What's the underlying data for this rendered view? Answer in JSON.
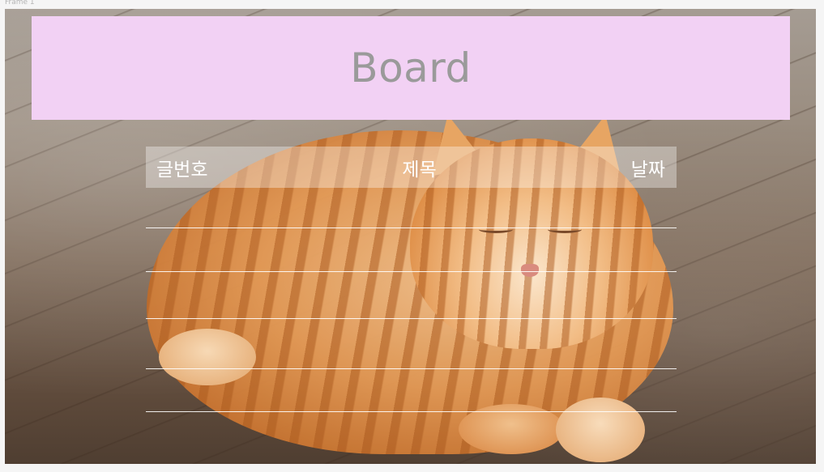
{
  "frame": {
    "label": "Frame 1"
  },
  "header": {
    "title": "Board"
  },
  "table": {
    "columns": [
      "글번호",
      "제목",
      "날짜"
    ],
    "rows": [
      {
        "number": "",
        "title": "",
        "date": ""
      },
      {
        "number": "",
        "title": "",
        "date": ""
      },
      {
        "number": "",
        "title": "",
        "date": ""
      },
      {
        "number": "",
        "title": "",
        "date": ""
      },
      {
        "number": "",
        "title": "",
        "date": ""
      }
    ]
  },
  "colors": {
    "header_bg": "#f2d1f4",
    "title_text": "#9a9a9a",
    "table_header_bg": "rgba(255,255,255,0.35)",
    "table_text": "#ffffff"
  },
  "background_image": "orange tabby cat lying on wooden floor"
}
